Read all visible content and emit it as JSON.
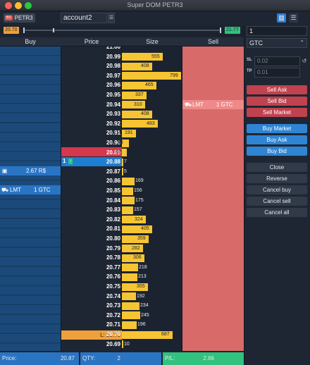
{
  "window": {
    "title": "Super DOM PETR3"
  },
  "toolbar": {
    "symbol_flag": "BS",
    "symbol": "PETR3",
    "account": "account2",
    "account_button_icon": "list-icon",
    "layout_icon": "columns-icon",
    "menu_icon": "hamburger-icon"
  },
  "range": {
    "low": "20.70",
    "high": "21.77"
  },
  "columns": {
    "buy": "Buy",
    "price": "Price",
    "size": "Size",
    "sell": "Sell"
  },
  "ladder": [
    {
      "price": "21.00",
      "size": 0
    },
    {
      "price": "20.99",
      "size": 555
    },
    {
      "price": "20.98",
      "size": 408
    },
    {
      "price": "20.97",
      "size": 799
    },
    {
      "price": "20.96",
      "size": 465
    },
    {
      "price": "20.95",
      "size": 337
    },
    {
      "price": "20.94",
      "size": 310
    },
    {
      "price": "20.93",
      "size": 408
    },
    {
      "price": "20.92",
      "size": 483
    },
    {
      "price": "20.91",
      "size": 191
    },
    {
      "price": "20.90",
      "size": 98
    },
    {
      "price": "20.89",
      "size": 67
    },
    {
      "price": "20.88",
      "size": 7
    },
    {
      "price": "20.87",
      "size": 5
    },
    {
      "price": "20.86",
      "size": 169
    },
    {
      "price": "20.85",
      "size": 156
    },
    {
      "price": "20.84",
      "size": 175
    },
    {
      "price": "20.83",
      "size": 157
    },
    {
      "price": "20.82",
      "size": 324
    },
    {
      "price": "20.81",
      "size": 405
    },
    {
      "price": "20.80",
      "size": 359
    },
    {
      "price": "20.79",
      "size": 282
    },
    {
      "price": "20.78",
      "size": 306
    },
    {
      "price": "20.77",
      "size": 218
    },
    {
      "price": "20.76",
      "size": 213
    },
    {
      "price": "20.75",
      "size": 355
    },
    {
      "price": "20.74",
      "size": 192
    },
    {
      "price": "20.73",
      "size": 234
    },
    {
      "price": "20.72",
      "size": 245
    },
    {
      "price": "20.71",
      "size": 196
    },
    {
      "price": "20.70",
      "size": 687
    },
    {
      "price": "20.69",
      "size": 10
    }
  ],
  "last": {
    "tag": "1",
    "arrow": "↑"
  },
  "low_marker": "L: 20.70",
  "position": {
    "value": "2.67 R$"
  },
  "buy_order": {
    "type": "LMT",
    "tif": "1 GTC"
  },
  "sell_order": {
    "type": "LMT",
    "tif": "1 GTC"
  },
  "footer": {
    "price_label": "Price:",
    "price_value": "20.87",
    "qty_label": "QTY:",
    "qty_value": "2",
    "pl_label": "P/L:",
    "pl_value": "2.66"
  },
  "panel": {
    "qty": "1",
    "tif": "GTC",
    "sl_label": "SL",
    "sl_value": "0.02",
    "tp_label": "TP",
    "tp_value": "0.01",
    "sell_ask": "Sell Ask",
    "sell_bid": "Sell Bid",
    "sell_market": "Sell Market",
    "buy_market": "Buy Market",
    "buy_ask": "Buy Ask",
    "buy_bid": "Buy Bid",
    "close": "Close",
    "reverse": "Reverse",
    "cancel_buy": "Cancel buy",
    "cancel_sell": "Cancel sell",
    "cancel_all": "Cancel all"
  },
  "colors": {
    "size_bar": "#f6c533",
    "sell_col": "#d96a6a",
    "buy_col": "#1b4a7a",
    "bid_price": "#d4384d",
    "last_price": "#1e7ed2",
    "footer_price": "#2a74c4",
    "footer_pl": "#30c27e"
  }
}
